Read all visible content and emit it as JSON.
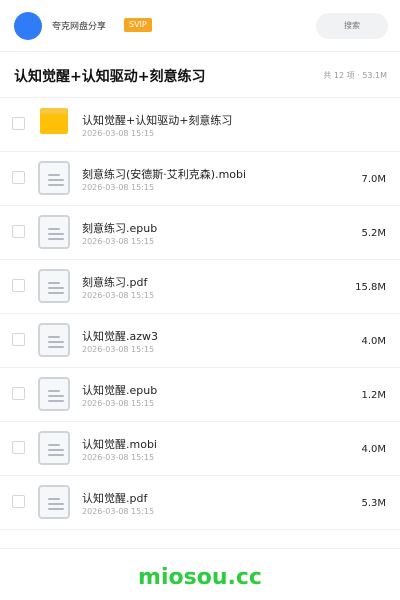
{
  "header": {
    "brand": "夸克网盘分享",
    "badge": "SVIP",
    "search_placeholder": "搜索"
  },
  "titlebar": {
    "title": "认知觉醒+认知驱动+刻意练习",
    "summary": "共 12 项 · 53.1M"
  },
  "files": [
    {
      "name": "认知觉醒+认知驱动+刻意练习",
      "date": "2026-03-08 15:15",
      "size": "",
      "type": "folder"
    },
    {
      "name": "刻意练习(安德斯·艾利克森).mobi",
      "date": "2026-03-08 15:15",
      "size": "7.0M",
      "type": "file"
    },
    {
      "name": "刻意练习.epub",
      "date": "2026-03-08 15:15",
      "size": "5.2M",
      "type": "file"
    },
    {
      "name": "刻意练习.pdf",
      "date": "2026-03-08 15:15",
      "size": "15.8M",
      "type": "file"
    },
    {
      "name": "认知觉醒.azw3",
      "date": "2026-03-08 15:15",
      "size": "4.0M",
      "type": "file"
    },
    {
      "name": "认知觉醒.epub",
      "date": "2026-03-08 15:15",
      "size": "1.2M",
      "type": "file"
    },
    {
      "name": "认知觉醒.mobi",
      "date": "2026-03-08 15:15",
      "size": "4.0M",
      "type": "file"
    },
    {
      "name": "认知觉醒.pdf",
      "date": "2026-03-08 15:15",
      "size": "5.3M",
      "type": "file"
    }
  ],
  "footer": {
    "watermark": "miosou.cc"
  },
  "colors": {
    "accent": "#2f7cf6",
    "badge": "#f5a623",
    "folder": "#ffc107",
    "watermark": "#2ecc40"
  }
}
